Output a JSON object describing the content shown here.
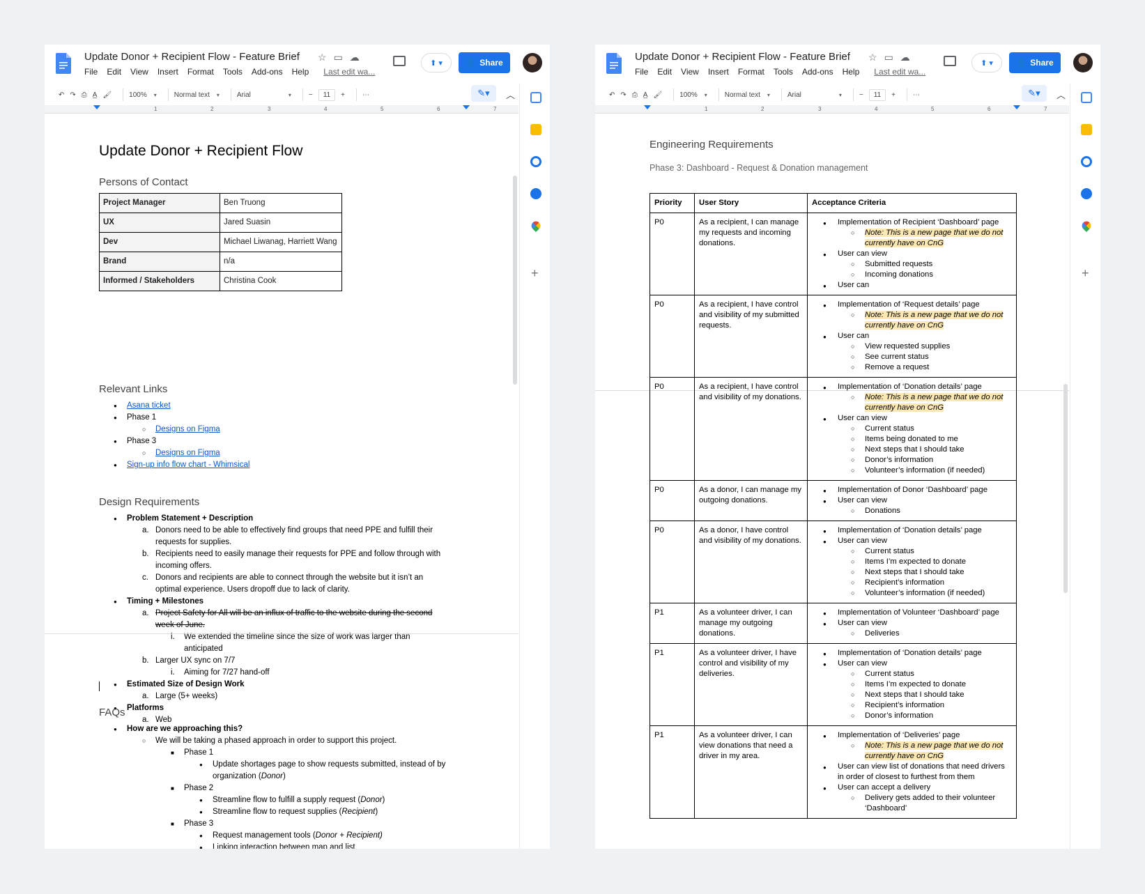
{
  "left": {
    "title": "Update Donor + Recipient Flow - Feature Brief",
    "menus": [
      "File",
      "Edit",
      "View",
      "Insert",
      "Format",
      "Tools",
      "Add-ons",
      "Help"
    ],
    "last_edit": "Last edit wa...",
    "share_label": "Share",
    "toolbar": {
      "zoom": "100%",
      "style": "Normal text",
      "font": "Arial",
      "size": "11"
    },
    "ruler": [
      "1",
      "2",
      "3",
      "4",
      "5",
      "6",
      "7"
    ],
    "doc": {
      "heading": "Update Donor + Recipient Flow",
      "contact_heading": "Persons of Contact",
      "contacts": [
        {
          "role": "Project Manager",
          "name": "Ben Truong"
        },
        {
          "role": "UX",
          "name": "Jared Suasin"
        },
        {
          "role": "Dev",
          "name": "Michael Liwanag, Harriett Wang"
        },
        {
          "role": "Brand",
          "name": "n/a"
        },
        {
          "role": "Informed / Stakeholders",
          "name": "Christina Cook"
        }
      ],
      "links_heading": "Relevant Links",
      "links": {
        "asana": "Asana ticket",
        "phase1": "Phase 1",
        "figma1": "Designs on Figma",
        "phase3": "Phase 3",
        "figma3": "Designs on Figma",
        "whimsical": "Sign-up info flow chart - Whimsical"
      },
      "design_heading": "Design Requirements",
      "design": {
        "problem": "Problem Statement + Description",
        "a1": "Donors need to be able to effectively find groups that need PPE and fulfill their",
        "a2": "requests for supplies.",
        "b1": "Recipients need to easily manage their requests for PPE and follow through with",
        "b2": "incoming offers.",
        "c1": "Donors and recipients are able to connect through the website but it isn’t an",
        "c2": "optimal experience. Users dropoff due to lack of clarity.",
        "timing": "Timing + Milestones",
        "t_a1": "Project Safety for All will be an influx of traffic to the website during the second",
        "t_a2": "week of June.",
        "t_i1": "We extended the timeline since the size of work was larger than",
        "t_i2": "anticipated",
        "t_b": "Larger UX sync on 7/7",
        "t_bi": "Aiming for 7/27 hand-off",
        "size": "Estimated Size of Design Work",
        "size_a": "Large (5+ weeks)",
        "platforms": "Platforms",
        "platforms_a": "Web"
      },
      "faq_heading": "FAQs",
      "faq": {
        "q1": "How are we approaching this?",
        "a1": "We will be taking a phased approach in order to support this project.",
        "p1": "Phase 1",
        "p1a1": "Update shortages page to show requests submitted, instead of by",
        "p1a2_pre": "organization (",
        "p1a2_em": "Donor",
        "p1a2_post": ")",
        "p2": "Phase 2",
        "p2a_pre": "Streamline flow to fulfill a supply request (",
        "p2a_em": "Donor",
        "p2b_pre": "Streamline flow to request supplies (",
        "p2b_em": "Recipient",
        "p3": "Phase 3",
        "p3a_pre": "Request management tools (",
        "p3a_em": "Donor + Recipient)",
        "p3b": "Linking interaction between map and list",
        "close_paren": ")"
      }
    }
  },
  "right": {
    "title": "Update Donor + Recipient Flow - Feature Brief",
    "menus": [
      "File",
      "Edit",
      "View",
      "Insert",
      "Format",
      "Tools",
      "Add-ons",
      "Help"
    ],
    "last_edit": "Last edit wa...",
    "share_label": "Share",
    "toolbar": {
      "zoom": "100%",
      "style": "Normal text",
      "font": "Arial",
      "size": "11"
    },
    "ruler": [
      "1",
      "2",
      "3",
      "4",
      "5",
      "6",
      "7"
    ],
    "doc": {
      "heading": "Engineering Requirements",
      "subheading": "Phase 3: Dashboard - Request & Donation management",
      "columns": [
        "Priority",
        "User Story",
        "Acceptance Criteria"
      ],
      "rows": [
        {
          "priority": "P0",
          "story": "As a recipient, I can manage my requests and incoming donations.",
          "criteria": [
            [
              "l1",
              "Implementation of Recipient ‘Dashboard’ page"
            ],
            [
              "hl",
              "Note: This is a new page that we do not currently have on CnG"
            ],
            [
              "l1",
              "User can view"
            ],
            [
              "l2",
              "Submitted requests"
            ],
            [
              "l2",
              "Incoming donations"
            ],
            [
              "l1",
              "User can"
            ]
          ]
        },
        {
          "priority": "P0",
          "story": "As a recipient, I have control and visibility of my submitted requests.",
          "criteria": [
            [
              "l1",
              "Implementation of ‘Request details’ page"
            ],
            [
              "hl",
              "Note: This is a new page that we do not currently have on CnG"
            ],
            [
              "l1",
              "User can"
            ],
            [
              "l2",
              "View requested supplies"
            ],
            [
              "l2",
              "See current status"
            ],
            [
              "l2",
              "Remove a request"
            ]
          ]
        },
        {
          "priority": "P0",
          "story": "As a recipient, I have control and visibility of my donations.",
          "criteria": [
            [
              "l1",
              "Implementation of ‘Donation details’ page"
            ],
            [
              "hl",
              "Note: This is a new page that we do not currently have on CnG"
            ],
            [
              "l1",
              "User can view"
            ],
            [
              "l2",
              "Current status"
            ],
            [
              "l2",
              "Items being donated to me"
            ],
            [
              "l2",
              "Next steps that I should take"
            ],
            [
              "l2",
              "Donor’s information"
            ],
            [
              "l2",
              "Volunteer’s information (if needed)"
            ]
          ]
        },
        {
          "priority": "P0",
          "story": "As a donor, I can manage my outgoing donations.",
          "criteria": [
            [
              "l1",
              "Implementation of Donor ‘Dashboard’ page"
            ],
            [
              "l1",
              "User can view"
            ],
            [
              "l2",
              "Donations"
            ]
          ]
        },
        {
          "priority": "P0",
          "story": "As a donor, I have control and visibility of my donations.",
          "criteria": [
            [
              "l1",
              "Implementation of ‘Donation details’ page"
            ],
            [
              "l1",
              "User can view"
            ],
            [
              "l2",
              "Current status"
            ],
            [
              "l2",
              "Items I’m expected to donate"
            ],
            [
              "l2",
              "Next steps that I should take"
            ],
            [
              "l2",
              "Recipient’s information"
            ],
            [
              "l2",
              "Volunteer’s information (if needed)"
            ]
          ]
        },
        {
          "priority": "P1",
          "story": "As a volunteer driver, I can manage my outgoing donations.",
          "criteria": [
            [
              "l1",
              "Implementation of Volunteer ‘Dashboard’ page"
            ],
            [
              "l1",
              "User can view"
            ],
            [
              "l2",
              "Deliveries"
            ]
          ]
        },
        {
          "priority": "P1",
          "story": "As a volunteer driver, I have control and visibility of my deliveries.",
          "criteria": [
            [
              "l1",
              "Implementation of ‘Donation details’ page"
            ],
            [
              "l1",
              "User can view"
            ],
            [
              "l2",
              "Current status"
            ],
            [
              "l2",
              "Items I’m expected to donate"
            ],
            [
              "l2",
              "Next steps that I should take"
            ],
            [
              "l2",
              "Recipient’s information"
            ],
            [
              "l2",
              "Donor’s information"
            ]
          ]
        },
        {
          "priority": "P1",
          "story": "As a volunteer driver, I can view donations that need a driver in my area.",
          "criteria": [
            [
              "l1",
              "Implementation of ‘Deliveries’ page"
            ],
            [
              "hl",
              "Note: This is a new page that we do not currently have on CnG"
            ],
            [
              "l1",
              "User can view list of donations that need drivers in order of closest to furthest from them"
            ],
            [
              "l1",
              "User can accept a delivery"
            ],
            [
              "l2",
              "Delivery gets added to their volunteer ‘Dashboard’"
            ]
          ]
        }
      ]
    }
  },
  "colors": {
    "accent": "#1a73e8",
    "link": "#1155cc",
    "highlight": "#fce8b2",
    "background": "#eef2f5"
  }
}
